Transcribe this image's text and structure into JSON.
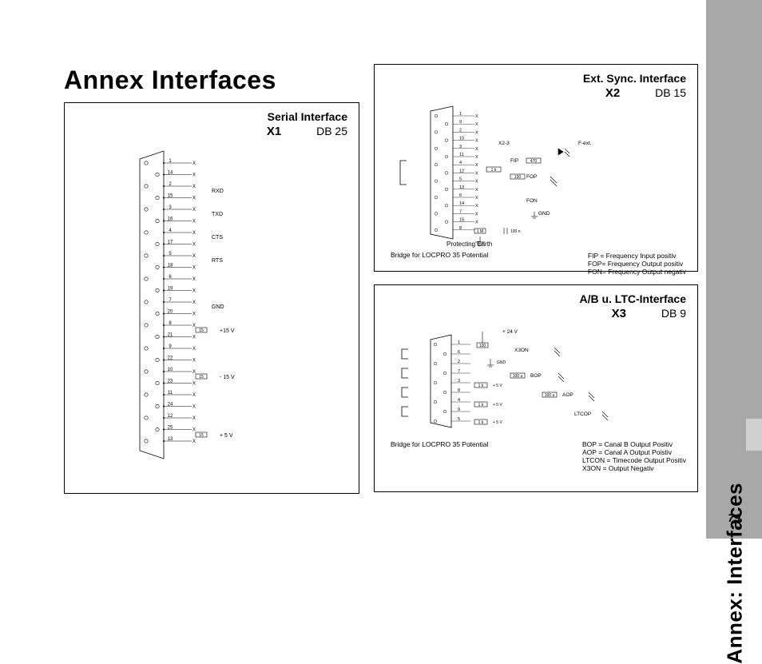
{
  "sidebar": {
    "title": "Annex: Interfaces",
    "page_number": "79"
  },
  "page": {
    "title": "Annex Interfaces"
  },
  "panel1": {
    "title_line1": "Serial Interface",
    "connector": "X1",
    "db": "DB 25",
    "pins": [
      "1",
      "14",
      "2",
      "15",
      "3",
      "16",
      "4",
      "17",
      "5",
      "18",
      "6",
      "19",
      "7",
      "20",
      "8",
      "21",
      "9",
      "22",
      "10",
      "23",
      "11",
      "24",
      "12",
      "25",
      "13"
    ],
    "labels": {
      "rxd": "RXD",
      "txd": "TXD",
      "cts": "CTS",
      "rts": "RTS",
      "gnd": "GND",
      "p15v": "+15 V",
      "m15v": "- 15 V",
      "p5v": "+ 5 V"
    },
    "r_label": "15"
  },
  "panel2": {
    "title_line1": "Ext. Sync. Interface",
    "connector": "X2",
    "db": "DB 15",
    "pins": [
      "1",
      "9",
      "2",
      "10",
      "3",
      "11",
      "4",
      "12",
      "5",
      "13",
      "6",
      "14",
      "7",
      "15",
      "8"
    ],
    "labels": {
      "x23": "X2-3",
      "fip": "FIP",
      "fop": "FOP",
      "fon": "FON",
      "gnd": "GND",
      "fext": "F-ext.",
      "r470": "470",
      "r1k": "1 k",
      "r100": "100",
      "r1m": "1 M",
      "c100n": "100 n",
      "pe": "Protecting Earth"
    },
    "bridge_note": "Bridge for LOCPRO 35 Potential",
    "legend": {
      "fip": "FIP = Frequency Input positiv",
      "fop": "FOP= Frequency Output positiv",
      "fon": "FON= Frequency Output negativ"
    }
  },
  "panel3": {
    "title_line1": "A/B u. LTC-Interface",
    "connector": "X3",
    "db": "DB 9",
    "pins": [
      "1",
      "6",
      "2",
      "7",
      "3",
      "8",
      "4",
      "9",
      "5"
    ],
    "labels": {
      "p24v": "+ 24 V",
      "x3on": "X3ON",
      "gnd": "GND",
      "bop": "BOP",
      "aop": "AOP",
      "ltcop": "LTCOP",
      "p5v": "+ 5 V",
      "r100": "100",
      "r1k": "1 k",
      "r100u": "100 u"
    },
    "bridge_note": "Bridge for LOCPRO 35 Potential",
    "legend": {
      "bop": "BOP = Canal B Output Positiv",
      "aop": "AOP = Canal A Output Poistiv",
      "ltcon": "LTCON = Timecode Output Positiv",
      "x3on": "X3ON = Output Negativ"
    }
  }
}
